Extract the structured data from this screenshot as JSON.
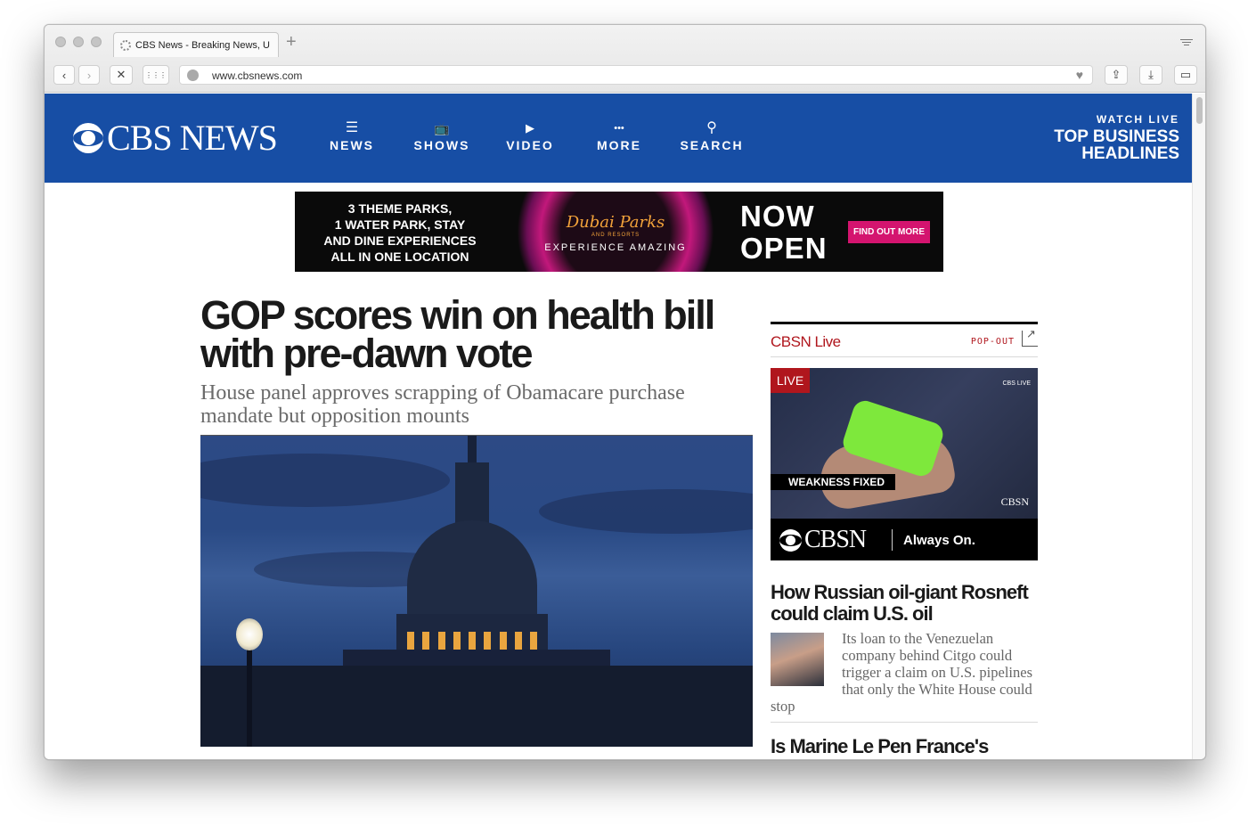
{
  "browser": {
    "tab_title": "CBS News - Breaking News, U",
    "new_tab_label": "+",
    "url": "www.cbsnews.com",
    "back_glyph": "‹",
    "forward_glyph": "›",
    "stop_glyph": "✕",
    "apps_glyph": "⋮⋮⋮",
    "heart_glyph": "♥",
    "share_glyph": "⇪",
    "download_glyph": "⤓",
    "battery_glyph": "▭"
  },
  "masthead": {
    "logo_text": "CBS NEWS",
    "menu": [
      {
        "label": "NEWS",
        "glyph": "☰"
      },
      {
        "label": "SHOWS",
        "glyph": "📺"
      },
      {
        "label": "VIDEO",
        "glyph": "▶"
      },
      {
        "label": "MORE",
        "glyph": "•••"
      },
      {
        "label": "SEARCH",
        "glyph": "⚲"
      }
    ],
    "watch_live": {
      "kicker": "WATCH LIVE",
      "headline_line1": "TOP BUSINESS",
      "headline_line2": "HEADLINES"
    }
  },
  "ad": {
    "left_line1": "3 THEME PARKS,",
    "left_line2": "1 WATER PARK, STAY",
    "left_line3": "AND DINE EXPERIENCES",
    "left_line4": "ALL IN ONE LOCATION",
    "brand": "Dubai Parks",
    "brand_sub": "AND RESORTS",
    "tagline": "EXPERIENCE AMAZING",
    "open_line1": "NOW",
    "open_line2": "OPEN",
    "button": "FIND OUT MORE"
  },
  "lead": {
    "headline": "GOP scores win on health bill with pre-dawn vote",
    "deck": "House panel approves scrapping of Obamacare purchase mandate but opposition mounts"
  },
  "cbsn": {
    "title": "CBSN Live",
    "popout": "POP-OUT",
    "live_tag": "LIVE",
    "corner_bug": "CBS LIVE",
    "lower_third": "WEAKNESS FIXED",
    "bug": "CBSN",
    "brand_name": "CBSN",
    "brand_tag": "Always On."
  },
  "stories": [
    {
      "title": "How Russian oil-giant Rosneft could claim U.S. oil",
      "body": "Its loan to the Venezuelan company behind Citgo could trigger a claim on U.S. pipelines that only the White House could stop"
    },
    {
      "title": "Is Marine Le Pen France's Trump?"
    }
  ],
  "colors": {
    "masthead_blue": "#174ea5",
    "cbsn_red": "#b0161d",
    "ad_pink": "#d4146f"
  }
}
